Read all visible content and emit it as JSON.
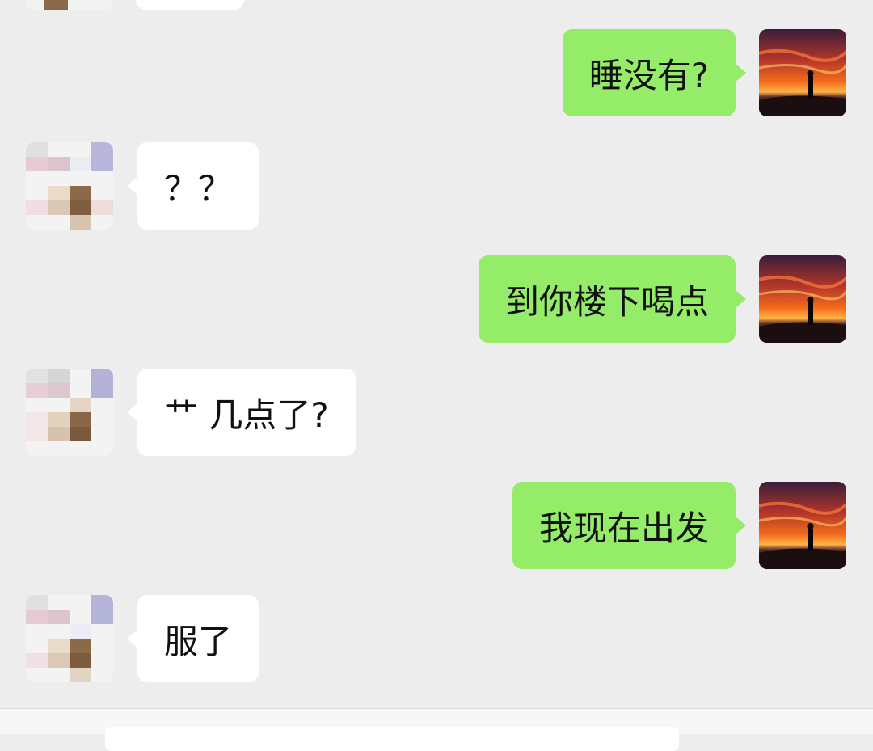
{
  "messages": [
    {
      "side": "self",
      "text": "睡没有?"
    },
    {
      "side": "other",
      "text": "？？"
    },
    {
      "side": "self",
      "text": "到你楼下喝点"
    },
    {
      "side": "other",
      "text": "艹 几点了?"
    },
    {
      "side": "self",
      "text": "我现在出发"
    },
    {
      "side": "other",
      "text": "服了"
    }
  ],
  "colors": {
    "background": "#ededed",
    "self_bubble": "#95ec69",
    "other_bubble": "#ffffff",
    "text": "#111111"
  }
}
